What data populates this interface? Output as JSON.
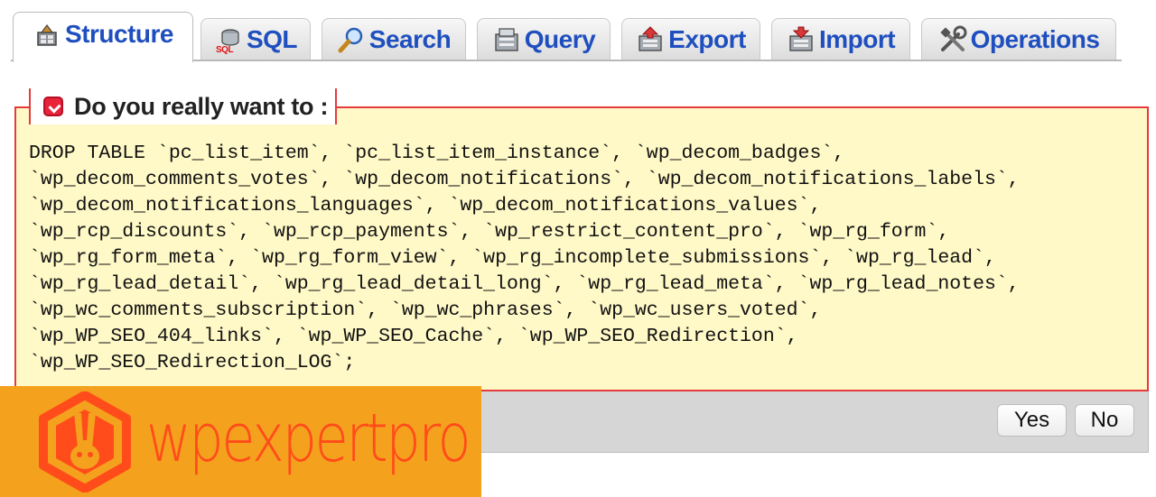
{
  "tabs": [
    {
      "id": "structure",
      "label": "Structure",
      "icon": "structure-icon",
      "active": true
    },
    {
      "id": "sql",
      "label": "SQL",
      "icon": "sql-icon",
      "active": false
    },
    {
      "id": "search",
      "label": "Search",
      "icon": "search-icon",
      "active": false
    },
    {
      "id": "query",
      "label": "Query",
      "icon": "query-icon",
      "active": false
    },
    {
      "id": "export",
      "label": "Export",
      "icon": "export-icon",
      "active": false
    },
    {
      "id": "import",
      "label": "Import",
      "icon": "import-icon",
      "active": false
    },
    {
      "id": "operations",
      "label": "Operations",
      "icon": "operations-icon",
      "active": false
    }
  ],
  "dialog": {
    "title": "Do you really want to :",
    "icon": "warning-icon",
    "sql": "DROP TABLE `pc_list_item`, `pc_list_item_instance`, `wp_decom_badges`,\n`wp_decom_comments_votes`, `wp_decom_notifications`, `wp_decom_notifications_labels`,\n`wp_decom_notifications_languages`, `wp_decom_notifications_values`,\n`wp_rcp_discounts`, `wp_rcp_payments`, `wp_restrict_content_pro`, `wp_rg_form`,\n`wp_rg_form_meta`, `wp_rg_form_view`, `wp_rg_incomplete_submissions`, `wp_rg_lead`,\n`wp_rg_lead_detail`, `wp_rg_lead_detail_long`, `wp_rg_lead_meta`, `wp_rg_lead_notes`,\n`wp_wc_comments_subscription`, `wp_wc_phrases`, `wp_wc_users_voted`,\n`wp_WP_SEO_404_links`, `wp_WP_SEO_Cache`, `wp_WP_SEO_Redirection`,\n`wp_WP_SEO_Redirection_LOG`;",
    "yes_label": "Yes",
    "no_label": "No"
  },
  "watermark": {
    "brand": "wpexpertpro",
    "logo": "rabbit-hexagon-logo"
  },
  "colors": {
    "tab_text": "#1f4fbf",
    "dialog_border": "#e53b3b",
    "dialog_bg": "#fff8c7",
    "banner_bg": "#f4a11e",
    "brand_text": "#ff4c1a"
  }
}
